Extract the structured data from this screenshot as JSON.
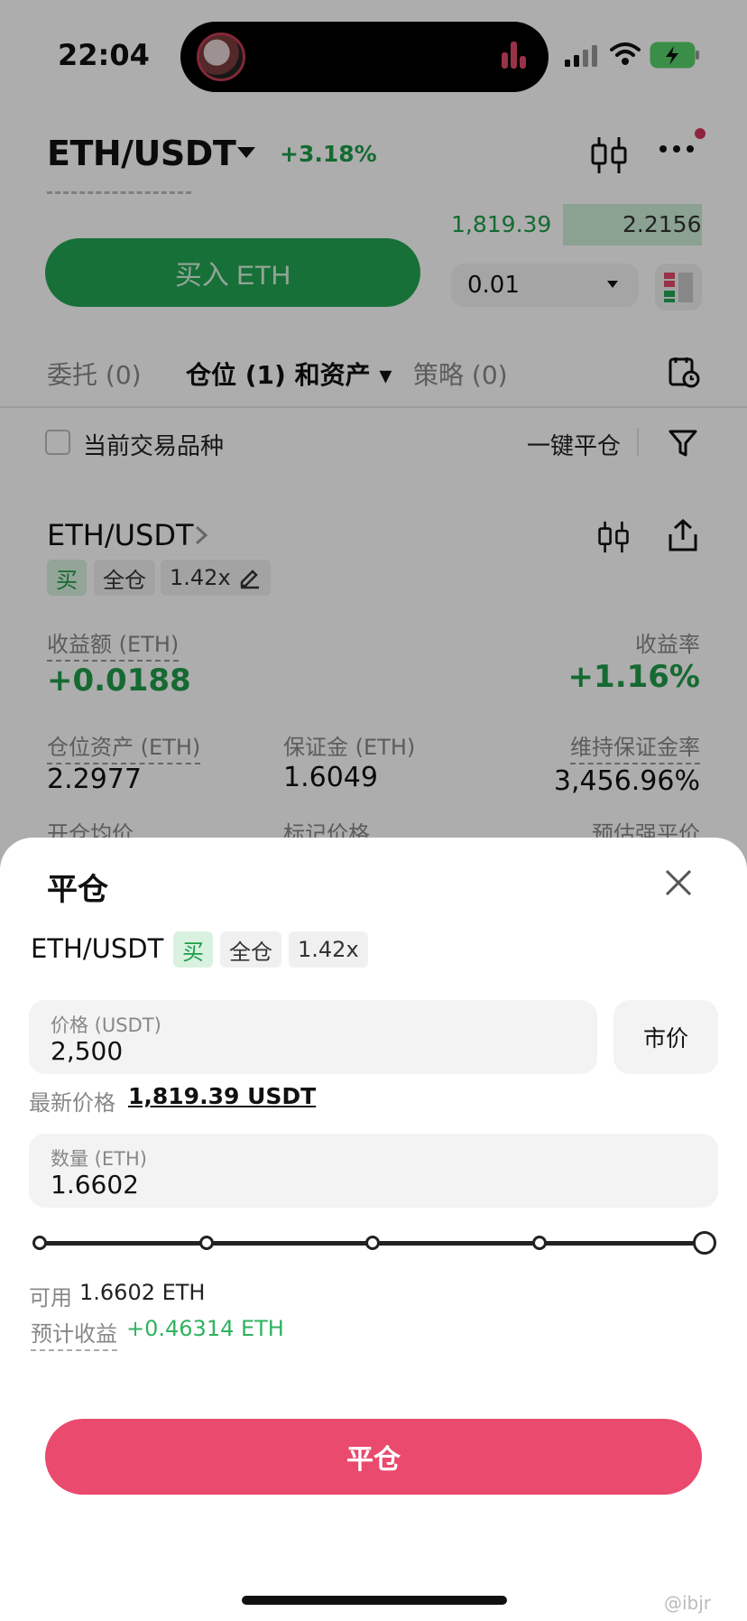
{
  "status_bar": {
    "time": "22:04"
  },
  "header": {
    "pair": "ETH/USDT",
    "change": "+3.18%"
  },
  "order_book": {
    "price": "1,819.39",
    "size": "2.2156"
  },
  "trade": {
    "buy_label": "买入 ETH",
    "quantity_value": "0.01"
  },
  "tabs": [
    {
      "label": "委托 (0)"
    },
    {
      "label": "仓位 (1) 和资产 ▾"
    },
    {
      "label": "策略 (0)"
    }
  ],
  "filters": {
    "current_pair_label": "当前交易品种",
    "close_all_label": "一键平仓"
  },
  "position": {
    "pair": "ETH/USDT",
    "side_tag": "买",
    "margin_mode_tag": "全仓",
    "leverage_tag": "1.42x",
    "pnl_label": "收益额 (ETH)",
    "pnl_value": "+0.0188",
    "roe_label": "收益率",
    "roe_value": "+1.16%",
    "asset_label": "仓位资产 (ETH)",
    "asset_value": "2.2977",
    "margin_label": "保证金 (ETH)",
    "margin_value": "1.6049",
    "mmr_label": "维持保证金率",
    "mmr_value": "3,456.96%",
    "entry_label": "开仓均价",
    "mark_label": "标记价格",
    "liq_label": "预估强平价"
  },
  "sheet": {
    "title": "平仓",
    "pair": "ETH/USDT",
    "side_tag": "买",
    "margin_mode_tag": "全仓",
    "leverage_tag": "1.42x",
    "price_label": "价格 (USDT)",
    "price_value": "2,500",
    "market_label": "市价",
    "latest_label": "最新价格",
    "latest_value": "1,819.39 USDT",
    "qty_label": "数量 (ETH)",
    "qty_value": "1.6602",
    "slider_fraction": 1.0,
    "available_label": "可用",
    "available_value": "1.6602 ETH",
    "est_label": "预计收益",
    "est_value": "+0.46314 ETH",
    "confirm_label": "平仓"
  },
  "watermark": "@ibjr",
  "colors": {
    "green": "#1f9d4a",
    "buy_button": "#22a652",
    "close_button": "#ea4a6d"
  }
}
